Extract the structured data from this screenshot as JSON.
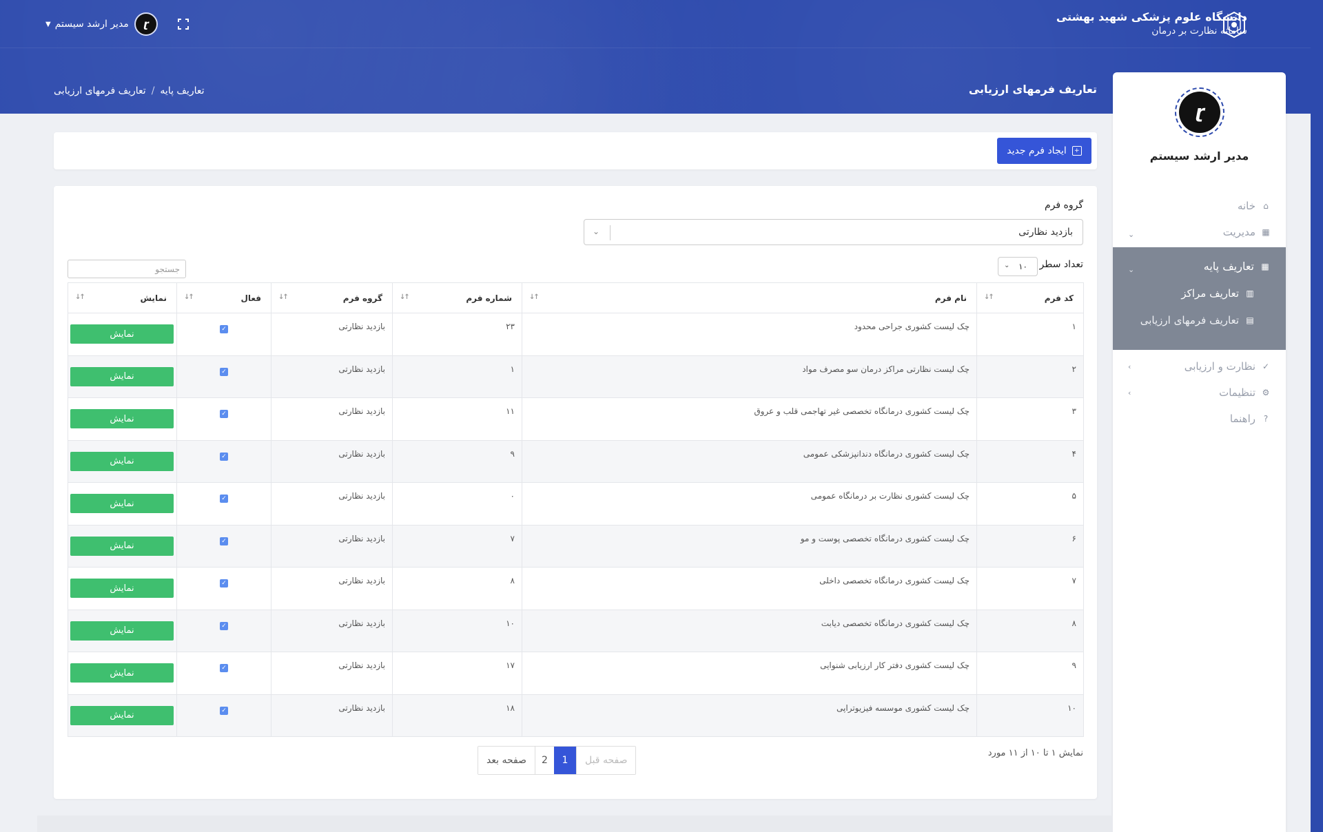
{
  "header": {
    "brand_title": "دانشگاه علوم پزشکی شهید بهشتی",
    "brand_subtitle": "سامانه نظارت بر درمان",
    "user_name": "مدیر ارشد سیستم",
    "page_title": "تعاریف فرمهای ارزیابی",
    "breadcrumb": [
      "تعاریف پایه",
      "تعاریف فرمهای ارزیابی"
    ]
  },
  "sidebar": {
    "user_name": "مدیر ارشد سیستم",
    "items": [
      {
        "label": "خانه",
        "icon": "home-icon"
      },
      {
        "label": "مدیریت",
        "icon": "grid-icon"
      },
      {
        "label": "تعاریف پایه",
        "icon": "grid-icon"
      },
      {
        "label": "تعاریف مراکز",
        "icon": "building-icon"
      },
      {
        "label": "تعاریف فرمهای ارزیابی",
        "icon": "form-icon"
      },
      {
        "label": "نظارت و ارزیابی",
        "icon": "user-check-icon"
      },
      {
        "label": "تنظیمات",
        "icon": "gear-icon"
      },
      {
        "label": "راهنما",
        "icon": "question-icon"
      }
    ]
  },
  "toolbar": {
    "new_form_label": "ایجاد فرم جدید"
  },
  "filter": {
    "group_label": "گروه فرم",
    "group_value": "بازدید نظارتی",
    "rows_label": "تعداد سطر",
    "rows_value": "۱۰",
    "search_placeholder": "جستجو"
  },
  "table": {
    "columns": [
      "کد فرم",
      "نام فرم",
      "شماره فرم",
      "گروه فرم",
      "فعال",
      "نمایش"
    ],
    "show_label": "نمایش",
    "rows": [
      {
        "code": "۱",
        "name": "چک لیست کشوری جراحی محدود",
        "number": "۲۳",
        "group": "بازدید نظارتی"
      },
      {
        "code": "۲",
        "name": "چک لیست نظارتی مراکز درمان سو مصرف مواد",
        "number": "۱",
        "group": "بازدید نظارتی"
      },
      {
        "code": "۳",
        "name": "چک لیست کشوری درمانگاه تخصصی غیر تهاجمی قلب و عروق",
        "number": "۱۱",
        "group": "بازدید نظارتی"
      },
      {
        "code": "۴",
        "name": "چک لیست کشوری درمانگاه دندانپزشکی عمومی",
        "number": "۹",
        "group": "بازدید نظارتی"
      },
      {
        "code": "۵",
        "name": "چک لیست کشوری نظارت بر درمانگاه عمومی",
        "number": "۰",
        "group": "بازدید نظارتی"
      },
      {
        "code": "۶",
        "name": "چک لیست کشوری درمانگاه تخصصی پوست و مو",
        "number": "۷",
        "group": "بازدید نظارتی"
      },
      {
        "code": "۷",
        "name": "چک لیست کشوری درمانگاه تخصصی داخلی",
        "number": "۸",
        "group": "بازدید نظارتی"
      },
      {
        "code": "۸",
        "name": "چک لیست کشوری درمانگاه تخصصی دیابت",
        "number": "۱۰",
        "group": "بازدید نظارتی"
      },
      {
        "code": "۹",
        "name": "چک لیست کشوری دفتر کار ارزیابی شنوایی",
        "number": "۱۷",
        "group": "بازدید نظارتی"
      },
      {
        "code": "۱۰",
        "name": "چک لیست کشوری موسسه فیزیوتراپی",
        "number": "۱۸",
        "group": "بازدید نظارتی"
      }
    ]
  },
  "pagination": {
    "info": "نمایش ۱ تا ۱۰ از ۱۱ مورد",
    "prev": "صفحه قبل",
    "pages": [
      "1",
      "2"
    ],
    "next": "صفحه بعد"
  },
  "colors": {
    "header": "#2d4aad",
    "primary_button": "#3555d8",
    "show_button": "#3fbf6f",
    "sidebar_active": "#7f8795"
  }
}
